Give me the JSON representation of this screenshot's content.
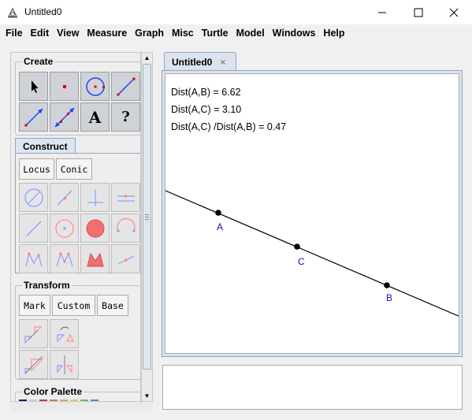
{
  "window": {
    "title": "Untitled0",
    "minimize_icon": "minimize-icon",
    "maximize_icon": "maximize-icon",
    "close_icon": "close-icon"
  },
  "menu": [
    "File",
    "Edit",
    "View",
    "Measure",
    "Graph",
    "Misc",
    "Turtle",
    "Model",
    "Windows",
    "Help"
  ],
  "toolbox": {
    "create": {
      "title": "Create",
      "tools": [
        "arrow-select",
        "point",
        "circle",
        "line-segment",
        "ray",
        "line",
        "text-label",
        "help"
      ],
      "text_tool": "A",
      "help_tool": "?"
    },
    "construct": {
      "title": "Construct",
      "buttons": [
        "Locus",
        "Conic"
      ],
      "tools": [
        "circle-by-center",
        "perpendicular",
        "intersection",
        "parallel",
        "segment",
        "circle-center-point",
        "filled-circle",
        "arc",
        "polygon",
        "polygon-points",
        "filled-polygon",
        "vector"
      ]
    },
    "transform": {
      "title": "Transform",
      "buttons": [
        "Mark",
        "Custom",
        "Base"
      ],
      "tools": [
        "translate",
        "rotate",
        "dilate",
        "reflect"
      ]
    },
    "color_palette": {
      "title": "Color Palette"
    }
  },
  "document": {
    "tab_label": "Untitled0",
    "tab_close": "×",
    "measurements": [
      "Dist(A,B) = 6.62",
      "Dist(A,C) = 3.10",
      "Dist(A,C) /Dist(A,B)  = 0.47"
    ],
    "points": [
      {
        "label": "A"
      },
      {
        "label": "C"
      },
      {
        "label": "B"
      }
    ],
    "point_color": "#1010c0"
  },
  "scrollbar": {
    "up": "▲",
    "down": "▼"
  }
}
